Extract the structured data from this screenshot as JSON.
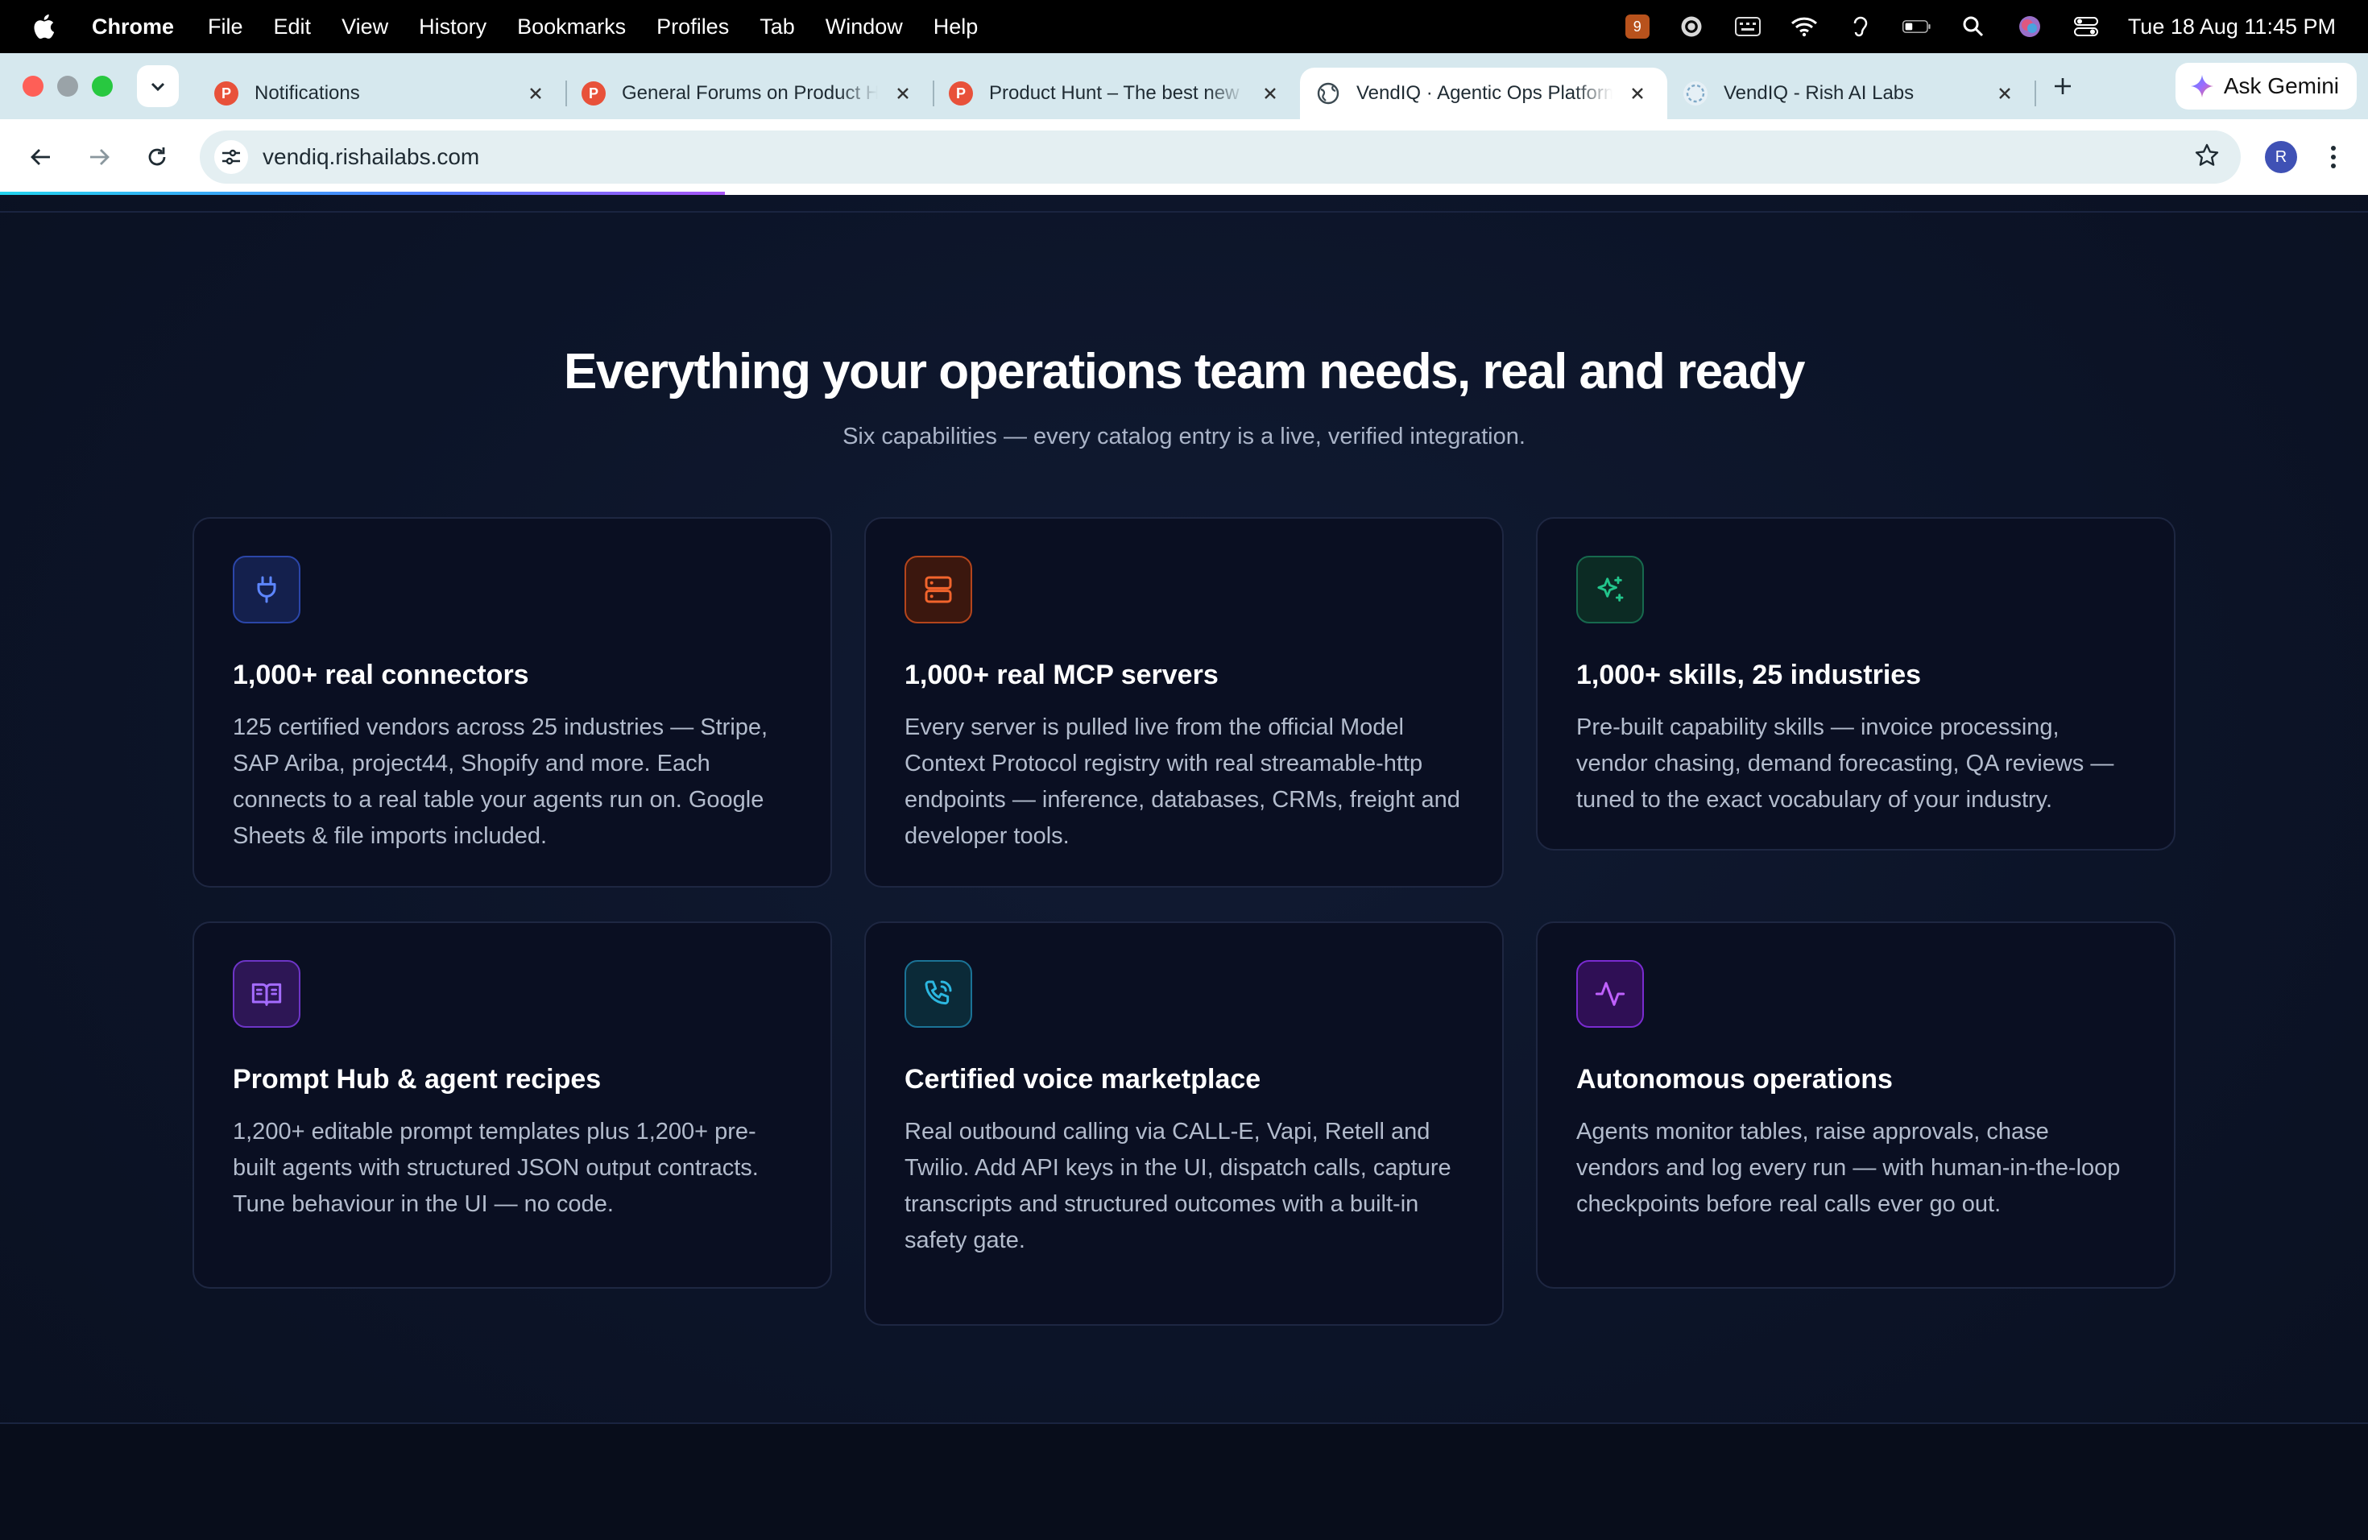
{
  "menubar": {
    "app_name": "Chrome",
    "menus": [
      "File",
      "Edit",
      "View",
      "History",
      "Bookmarks",
      "Profiles",
      "Tab",
      "Window",
      "Help"
    ],
    "notification_badge": "9",
    "clock": "Tue 18 Aug  11:45 PM"
  },
  "tabs": [
    {
      "title": "Notifications",
      "icon": "product-hunt-icon",
      "active": false
    },
    {
      "title": "General Forums on Product Hunt",
      "icon": "product-hunt-icon",
      "active": false
    },
    {
      "title": "Product Hunt – The best new products",
      "icon": "product-hunt-icon",
      "active": false
    },
    {
      "title": "VendIQ · Agentic Ops Platform",
      "icon": "globe-icon",
      "active": true
    },
    {
      "title": "VendIQ - Rish AI Labs",
      "icon": "rish-logo-icon",
      "active": false
    }
  ],
  "ask_gemini": "Ask Gemini",
  "toolbar": {
    "url": "vendiq.rishailabs.com",
    "avatar_initial": "R"
  },
  "section": {
    "heading": "Everything your operations team needs, real and ready",
    "subheading": "Six capabilities — every catalog entry is a live, verified integration."
  },
  "cards": [
    {
      "icon": "plug-icon",
      "title": "1,000+ real connectors",
      "body": "125 certified vendors across 25 industries — Stripe, SAP Ariba, project44, Shopify and more. Each connects to a real table your agents run on. Google Sheets & file imports included.",
      "accent": "#4f7cff"
    },
    {
      "icon": "server-icon",
      "title": "1,000+ real MCP servers",
      "body": "Every server is pulled live from the official Model Context Protocol registry with real streamable-http endpoints — inference, databases, CRMs, freight and developer tools.",
      "accent": "#f2642c"
    },
    {
      "icon": "sparkles-icon",
      "title": "1,000+ skills, 25 industries",
      "body": "Pre-built capability skills — invoice processing, vendor chasing, demand forecasting, QA reviews — tuned to the exact vocabulary of your industry.",
      "accent": "#22c58b"
    },
    {
      "icon": "book-open-icon",
      "title": "Prompt Hub & agent recipes",
      "body": "1,200+ editable prompt templates plus 1,200+ pre-built agents with structured JSON output contracts. Tune behaviour in the UI — no code.",
      "accent": "#a46cff"
    },
    {
      "icon": "phone-call-icon",
      "title": "Certified voice marketplace",
      "body": "Real outbound calling via CALL-E, Vapi, Retell and Twilio. Add API keys in the UI, dispatch calls, capture transcripts and structured outcomes with a built-in safety gate.",
      "accent": "#2cb7e0"
    },
    {
      "icon": "activity-icon",
      "title": "Autonomous operations",
      "body": "Agents monitor tables, raise approvals, chase vendors and log every run — with human-in-the-loop checkpoints before real calls ever go out.",
      "accent": "#c061ff"
    }
  ]
}
